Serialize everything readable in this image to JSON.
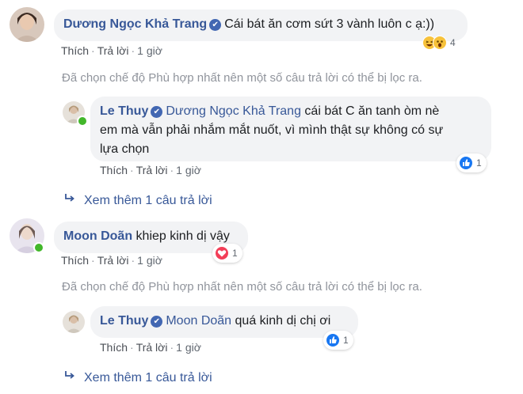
{
  "verified_mark": "✔",
  "colors": {
    "link": "#385898",
    "bubble": "#f2f3f5",
    "online": "#42b72a",
    "like": "#1877f2",
    "love": "#f33e58",
    "haha": "#f7c23b"
  },
  "comments": [
    {
      "author": "Dương Ngọc Khả Trang",
      "verified": true,
      "text": "Cái bát ăn cơm sứt 3 vành luôn c ạ:))",
      "actions": {
        "like": "Thích",
        "reply": "Trả lời",
        "time": "1 giờ"
      },
      "reactions": {
        "icons": [
          "haha-icon",
          "wow-icon"
        ],
        "count": "4"
      },
      "filter_note": "Đã chọn chế độ Phù hợp nhất nên một số câu trả lời có thể bị lọc ra.",
      "reply": {
        "author": "Le Thuy",
        "verified": true,
        "mention": "Dương Ngọc Khả Trang",
        "text_line1": "cái bát C ăn tanh òm nè",
        "text_line2": "em mà vẫn phải nhắm mắt nuốt, vì mình thật sự không có sự",
        "text_line3": "lựa chọn",
        "actions": {
          "like": "Thích",
          "reply": "Trả lời",
          "time": "1 giờ"
        },
        "reactions": {
          "icons": [
            "like-icon"
          ],
          "count": "1"
        }
      },
      "more_replies": "Xem thêm 1 câu trả lời"
    },
    {
      "author": "Moon Doãn",
      "verified": false,
      "text": "khiep kinh dị vậy",
      "actions": {
        "like": "Thích",
        "reply": "Trả lời",
        "time": "1 giờ"
      },
      "reactions": {
        "icons": [
          "love-icon"
        ],
        "count": "1"
      },
      "filter_note": "Đã chọn chế độ Phù hợp nhất nên một số câu trả lời có thể bị lọc ra.",
      "reply": {
        "author": "Le Thuy",
        "verified": true,
        "mention": "Moon Doãn",
        "text_line1": "quá kinh dị chị ơi",
        "actions": {
          "like": "Thích",
          "reply": "Trả lời",
          "time": "1 giờ"
        },
        "reactions": {
          "icons": [
            "like-icon"
          ],
          "count": "1"
        }
      },
      "more_replies": "Xem thêm 1 câu trả lời"
    }
  ]
}
